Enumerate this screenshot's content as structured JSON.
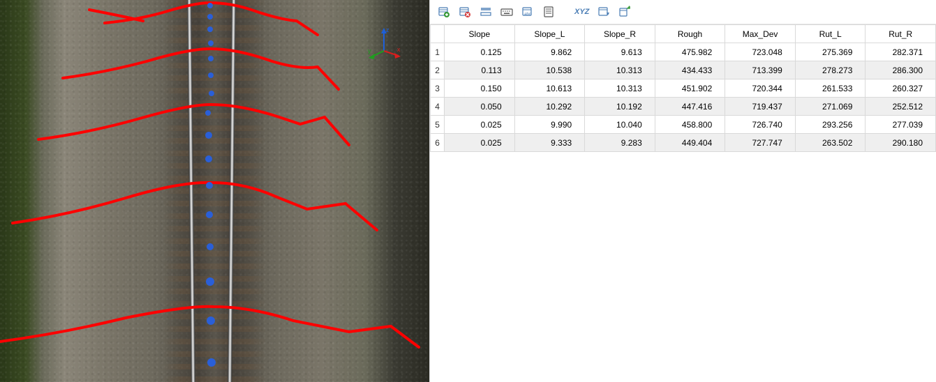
{
  "view3d": {
    "axis_labels": {
      "x": "x",
      "y": "y",
      "z": "z"
    },
    "axis_colors": {
      "x": "#d81e1e",
      "y": "#1e9e1e",
      "z": "#1e5fd8"
    },
    "profile_line_color": "#ff0000",
    "center_point_color": "#1e5fd8"
  },
  "toolbar": {
    "icons": [
      "add-row-icon",
      "delete-row-icon",
      "toggle-selection-icon",
      "keyboard-entry-icon",
      "rename-field-icon",
      "show-list-icon",
      "xyz-icon",
      "field-settings-icon",
      "export-icon"
    ],
    "xyz_label": "XYZ"
  },
  "table": {
    "columns": [
      "Slope",
      "Slope_L",
      "Slope_R",
      "Rough",
      "Max_Dev",
      "Rut_L",
      "Rut_R"
    ],
    "rows": [
      {
        "n": "1",
        "Slope": "0.125",
        "Slope_L": "9.862",
        "Slope_R": "9.613",
        "Rough": "475.982",
        "Max_Dev": "723.048",
        "Rut_L": "275.369",
        "Rut_R": "282.371"
      },
      {
        "n": "2",
        "Slope": "0.113",
        "Slope_L": "10.538",
        "Slope_R": "10.313",
        "Rough": "434.433",
        "Max_Dev": "713.399",
        "Rut_L": "278.273",
        "Rut_R": "286.300"
      },
      {
        "n": "3",
        "Slope": "0.150",
        "Slope_L": "10.613",
        "Slope_R": "10.313",
        "Rough": "451.902",
        "Max_Dev": "720.344",
        "Rut_L": "261.533",
        "Rut_R": "260.327"
      },
      {
        "n": "4",
        "Slope": "0.050",
        "Slope_L": "10.292",
        "Slope_R": "10.192",
        "Rough": "447.416",
        "Max_Dev": "719.437",
        "Rut_L": "271.069",
        "Rut_R": "252.512"
      },
      {
        "n": "5",
        "Slope": "0.025",
        "Slope_L": "9.990",
        "Slope_R": "10.040",
        "Rough": "458.800",
        "Max_Dev": "726.740",
        "Rut_L": "293.256",
        "Rut_R": "277.039"
      },
      {
        "n": "6",
        "Slope": "0.025",
        "Slope_L": "9.333",
        "Slope_R": "9.283",
        "Rough": "449.404",
        "Max_Dev": "727.747",
        "Rut_L": "263.502",
        "Rut_R": "290.180"
      }
    ]
  }
}
